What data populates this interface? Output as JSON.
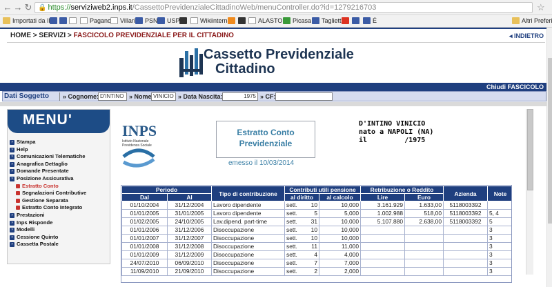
{
  "browser": {
    "url_scheme": "https://",
    "url_host": "serviziweb2.inps.it",
    "url_path": "/CassettoPrevidenzialeCittadinoWeb/menuController.do?id=1279216703",
    "bookmarks": [
      "Importati da IE",
      "Villari",
      "PSN",
      "USP",
      "Wikiinterna",
      "ALASTOR",
      "Picasa",
      "Taglietti",
      "É",
      "Altri Preferiti"
    ],
    "bookmark_pagano": "Pagano"
  },
  "breadcrumb": {
    "path": "HOME > SERVIZI > ",
    "current": "FASCICOLO PREVIDENZIALE PER IL CITTADINO"
  },
  "indietro": "INDIETRO",
  "header": {
    "title_line1": "Cassetto Previdenziale",
    "title_line2": "Cittadino"
  },
  "chiudi": "Chiudi FASCICOLO",
  "dati": {
    "label": "Dati Soggetto",
    "cognome_label": "Cognome:",
    "cognome": "D'INTINO",
    "nome_label": "Nome:",
    "nome": "VINICIO",
    "nascita_label": "Data Nascita:",
    "nascita": "1975",
    "cf_label": "CF:",
    "cf": ""
  },
  "menu": {
    "title": "MENU'",
    "items": [
      {
        "label": "Stampa",
        "sub": false,
        "active": false
      },
      {
        "label": "Help",
        "sub": false,
        "active": false
      },
      {
        "label": "Comunicazioni Telematiche",
        "sub": false,
        "active": false
      },
      {
        "label": "Anagrafica Dettaglio",
        "sub": false,
        "active": false
      },
      {
        "label": "Domande Presentate",
        "sub": false,
        "active": false
      },
      {
        "label": "Posizione Assicurativa",
        "sub": false,
        "active": false
      },
      {
        "label": "Estratto Conto",
        "sub": true,
        "active": true
      },
      {
        "label": "Segnalazioni Contributive",
        "sub": true,
        "active": false
      },
      {
        "label": "Gestione Separata",
        "sub": true,
        "active": false
      },
      {
        "label": "Estratto Conto Integrato",
        "sub": true,
        "active": false
      },
      {
        "label": "Prestazioni",
        "sub": false,
        "active": false
      },
      {
        "label": "Inps Risponde",
        "sub": false,
        "active": false
      },
      {
        "label": "Modelli",
        "sub": false,
        "active": false
      },
      {
        "label": "Cessione Quinto",
        "sub": false,
        "active": false
      },
      {
        "label": "Cassetta Postale",
        "sub": false,
        "active": false
      }
    ]
  },
  "inps_logo": {
    "brand": "INPS",
    "subtitle_1": "Istituto Nazionale",
    "subtitle_2": "Previdenza Sociale"
  },
  "estratto": {
    "line1": "Estratto Conto",
    "line2": "Previdenziale",
    "emesso": "emesso il 10/03/2014"
  },
  "person": {
    "name": "D'INTINO VINICIO",
    "born": "nato a NAPOLI (NA)",
    "il": "il         /1975"
  },
  "table": {
    "headers": {
      "periodo": "Periodo",
      "dal": "Dal",
      "al": "Al",
      "tipo": "Tipo di contribuzione",
      "contributi": "Contributi utili pensione",
      "al_diritto": "al diritto",
      "al_calcolo": "al calcolo",
      "retribuzione": "Retribuzione o Reddito",
      "lire": "Lire",
      "euro": "Euro",
      "azienda": "Azienda",
      "note": "Note"
    },
    "rows": [
      [
        "01/10/2004",
        "31/12/2004",
        "Lavoro dipendente",
        "sett.",
        "10",
        "10,000",
        "3.161.929",
        "1.633,00",
        "5118003392",
        ""
      ],
      [
        "01/01/2005",
        "31/01/2005",
        "Lavoro dipendente",
        "sett.",
        "5",
        "5,000",
        "1.002.988",
        "518,00",
        "5118003392",
        "5, 4"
      ],
      [
        "01/02/2005",
        "24/10/2005",
        "Lav.dipend. part-time",
        "sett.",
        "31",
        "10,000",
        "5.107.880",
        "2.638,00",
        "5118003392",
        "5"
      ],
      [
        "01/01/2006",
        "31/12/2006",
        "Disoccupazione",
        "sett.",
        "10",
        "10,000",
        "",
        "",
        "",
        "3"
      ],
      [
        "01/01/2007",
        "31/12/2007",
        "Disoccupazione",
        "sett.",
        "10",
        "10,000",
        "",
        "",
        "",
        "3"
      ],
      [
        "01/01/2008",
        "31/12/2008",
        "Disoccupazione",
        "sett.",
        "11",
        "11,000",
        "",
        "",
        "",
        "3"
      ],
      [
        "01/01/2009",
        "31/12/2009",
        "Disoccupazione",
        "sett.",
        "4",
        "4,000",
        "",
        "",
        "",
        "3"
      ],
      [
        "24/07/2010",
        "06/09/2010",
        "Disoccupazione",
        "sett.",
        "7",
        "7,000",
        "",
        "",
        "",
        "3"
      ],
      [
        "11/09/2010",
        "21/09/2010",
        "Disoccupazione",
        "sett.",
        "2",
        "2,000",
        "",
        "",
        "",
        "3"
      ]
    ]
  }
}
